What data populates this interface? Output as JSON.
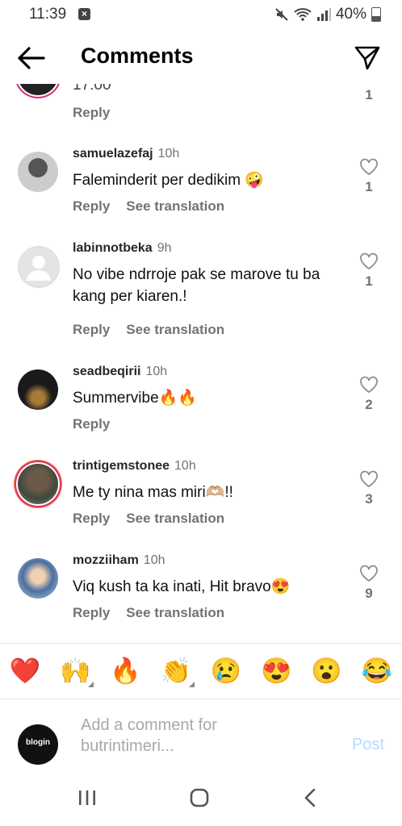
{
  "status_bar": {
    "time": "11:39",
    "battery": "40%"
  },
  "header": {
    "title": "Comments"
  },
  "partial_comment": {
    "text": "17:00",
    "reply_label": "Reply",
    "like_count": "1"
  },
  "comments": [
    {
      "user": "samuelazefaj",
      "time": "10h",
      "text": "Faleminderit per dedikim 🤪",
      "reply_label": "Reply",
      "translate_label": "See translation",
      "like_count": "1"
    },
    {
      "user": "labinnotbeka",
      "time": "9h",
      "text": "No vibe ndrroje pak se marove tu ba kang per kiaren.!",
      "reply_label": "Reply",
      "translate_label": "See translation",
      "like_count": "1"
    },
    {
      "user": "seadbeqirii",
      "time": "10h",
      "text": "Summervibe🔥🔥",
      "reply_label": "Reply",
      "like_count": "2"
    },
    {
      "user": "trintigemstonee",
      "time": "10h",
      "text": "Me ty nina mas miri🫶🏼!!",
      "reply_label": "Reply",
      "translate_label": "See translation",
      "like_count": "3"
    },
    {
      "user": "mozziiham",
      "time": "10h",
      "text": "Viq kush ta ka inati, Hit bravo😍",
      "reply_label": "Reply",
      "translate_label": "See translation",
      "like_count": "9"
    }
  ],
  "emoji_bar": [
    "❤️",
    "🙌",
    "🔥",
    "👏",
    "😢",
    "😍",
    "😮",
    "😂"
  ],
  "add_comment": {
    "avatar_text": "blogin",
    "placeholder": "Add a comment for butrintimeri...",
    "post_label": "Post"
  }
}
